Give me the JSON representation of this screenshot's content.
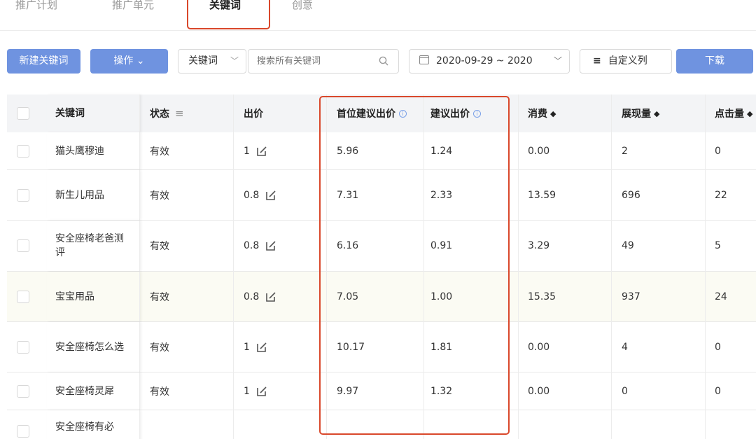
{
  "tabs": [
    "推广计划",
    "推广单元",
    "关键词",
    "创意"
  ],
  "toolbar": {
    "new_keyword": "新建关键词",
    "operation": "操作 ⌄",
    "keyword_select": "关键词",
    "search_placeholder": "搜索所有关键词",
    "date_range": "2020-09-29 ~ 2020",
    "custom_columns": "自定义列",
    "download": "下载"
  },
  "table": {
    "headers": {
      "keyword": "关键词",
      "status": "状态",
      "bid": "出价",
      "top_suggested_bid": "首位建议出价",
      "suggested_bid": "建议出价",
      "cost": "消费",
      "impressions": "展现量",
      "clicks": "点击量"
    },
    "rows": [
      {
        "keyword": "猫头鹰穆迪",
        "status": "有效",
        "bid": "1",
        "top": "5.96",
        "sugg": "1.24",
        "cost": "0.00",
        "imp": "2",
        "clicks": "0"
      },
      {
        "keyword": "新生儿用品",
        "status": "有效",
        "bid": "0.8",
        "top": "7.31",
        "sugg": "2.33",
        "cost": "13.59",
        "imp": "696",
        "clicks": "22"
      },
      {
        "keyword": "安全座椅老爸测评",
        "status": "有效",
        "bid": "0.8",
        "top": "6.16",
        "sugg": "0.91",
        "cost": "3.29",
        "imp": "49",
        "clicks": "5"
      },
      {
        "keyword": "宝宝用品",
        "status": "有效",
        "bid": "0.8",
        "top": "7.05",
        "sugg": "1.00",
        "cost": "15.35",
        "imp": "937",
        "clicks": "24"
      },
      {
        "keyword": "安全座椅怎么选",
        "status": "有效",
        "bid": "1",
        "top": "10.17",
        "sugg": "1.81",
        "cost": "0.00",
        "imp": "4",
        "clicks": "0"
      },
      {
        "keyword": "安全座椅灵犀",
        "status": "有效",
        "bid": "1",
        "top": "9.97",
        "sugg": "1.32",
        "cost": "0.00",
        "imp": "0",
        "clicks": "0"
      },
      {
        "keyword": "安全座椅有必",
        "status": "",
        "bid": "",
        "top": "",
        "sugg": "",
        "cost": "",
        "imp": "",
        "clicks": ""
      }
    ]
  },
  "colors": {
    "primary_button": "#6f93e0",
    "highlight_box": "#d9482b",
    "header_bg": "#f3f4f6"
  }
}
